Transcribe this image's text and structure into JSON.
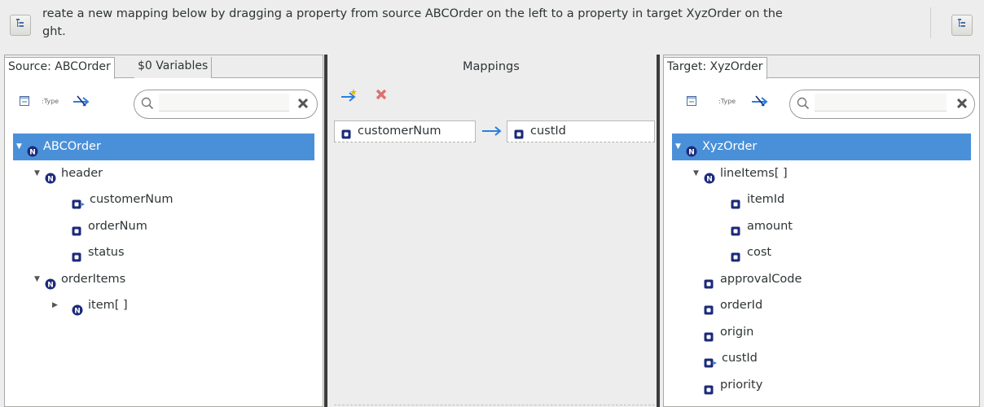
{
  "instruction": {
    "line1": "reate a new mapping below by dragging a property from source ABCOrder on the left to a property in target XyzOrder  on the",
    "line2": "ght."
  },
  "source": {
    "tabs": [
      "Source: ABCOrder",
      "$0 Variables"
    ],
    "tree": [
      {
        "label": "ABCOrder",
        "depth": 0,
        "expander": "open",
        "icon": "object-icon",
        "selected": true
      },
      {
        "label": "header",
        "depth": 1,
        "expander": "open",
        "icon": "object-icon"
      },
      {
        "label": "customerNum",
        "depth": 2,
        "expander": "none",
        "icon": "mapped-property-icon"
      },
      {
        "label": "orderNum",
        "depth": 2,
        "expander": "none",
        "icon": "property-icon"
      },
      {
        "label": "status",
        "depth": 2,
        "expander": "none",
        "icon": "property-icon"
      },
      {
        "label": "orderItems",
        "depth": 1,
        "expander": "open",
        "icon": "object-icon"
      },
      {
        "label": "item[ ]",
        "depth": 2,
        "expander": "closed",
        "icon": "object-icon"
      }
    ]
  },
  "mappings": {
    "title": "Mappings",
    "rows": [
      {
        "source": "customerNum",
        "target": "custId"
      }
    ]
  },
  "target": {
    "tabs": [
      "Target: XyzOrder"
    ],
    "tree": [
      {
        "label": "XyzOrder",
        "depth": 0,
        "expander": "open",
        "icon": "object-icon",
        "selected": true
      },
      {
        "label": "lineItems[ ]",
        "depth": 1,
        "expander": "open",
        "icon": "object-icon"
      },
      {
        "label": "itemId",
        "depth": 2,
        "expander": "none",
        "icon": "property-icon"
      },
      {
        "label": "amount",
        "depth": 2,
        "expander": "none",
        "icon": "property-icon"
      },
      {
        "label": "cost",
        "depth": 2,
        "expander": "none",
        "icon": "property-icon"
      },
      {
        "label": "approvalCode",
        "depth": 1,
        "expander": "none",
        "icon": "property-icon"
      },
      {
        "label": "orderId",
        "depth": 1,
        "expander": "none",
        "icon": "property-icon"
      },
      {
        "label": "origin",
        "depth": 1,
        "expander": "none",
        "icon": "property-icon"
      },
      {
        "label": "custId",
        "depth": 1,
        "expander": "none",
        "icon": "mapped-property-icon"
      },
      {
        "label": "priority",
        "depth": 1,
        "expander": "none",
        "icon": "property-icon"
      }
    ]
  },
  "colors": {
    "selection": "#4a90d9",
    "node_icon": "#1c2a7a",
    "map_arrow": "#2a7fe0",
    "delete": "#e07070"
  }
}
